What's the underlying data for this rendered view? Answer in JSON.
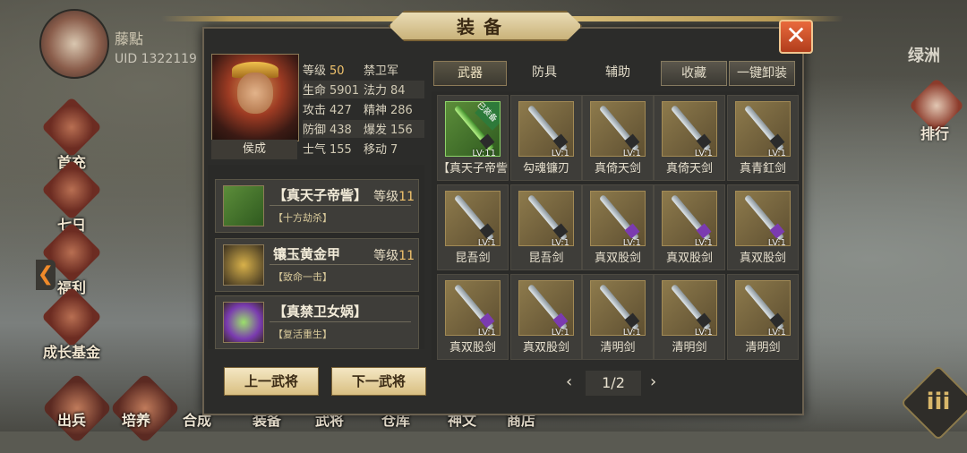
{
  "background": {
    "player_name": "藤點",
    "uid": "UID  1322119",
    "left_menu": [
      "首充",
      "七日",
      "福利",
      "成长基金"
    ],
    "bottom_menu": [
      "出兵",
      "培养",
      "合成",
      "装备",
      "武将",
      "仓库",
      "神文",
      "商店"
    ],
    "right_label": "绿洲",
    "rank_label": "排行"
  },
  "dialog": {
    "title": "装备",
    "close_symbol": "✕",
    "hero": {
      "name": "侯成",
      "stats": [
        [
          {
            "k": "等级",
            "v": "50",
            "highlight": true
          },
          {
            "k": "禁卫军",
            "v": ""
          }
        ],
        [
          {
            "k": "生命",
            "v": "5901"
          },
          {
            "k": "法力",
            "v": "84"
          }
        ],
        [
          {
            "k": "攻击",
            "v": "427"
          },
          {
            "k": "精神",
            "v": "286"
          }
        ],
        [
          {
            "k": "防御",
            "v": "438"
          },
          {
            "k": "爆发",
            "v": "156"
          }
        ],
        [
          {
            "k": "士气",
            "v": "155"
          },
          {
            "k": "移动",
            "v": "7"
          }
        ]
      ]
    },
    "equipped": [
      {
        "name": "【真天子帝訾】",
        "level_label": "等级",
        "level": "11",
        "skill": "【十方劫杀】",
        "icon": "sword-icon"
      },
      {
        "name": "镶玉黄金甲",
        "level_label": "等级",
        "level": "11",
        "skill": "【致命一击】",
        "icon": "armor-icon"
      },
      {
        "name": "【真禁卫女娲】",
        "level_label": "",
        "level": "",
        "skill": "【复活重生】",
        "icon": "gem-icon"
      }
    ],
    "prev_hero": "上一武将",
    "next_hero": "下一武将",
    "tabs": [
      "武器",
      "防具",
      "辅助"
    ],
    "favorite": "收藏",
    "unequip_all": "一键卸装",
    "equipped_badge": "已装备",
    "items": [
      {
        "name": "【真天子帝訾",
        "lv": "LV:11",
        "style": "green"
      },
      {
        "name": "勾魂镰刃",
        "lv": "LV:1",
        "style": "scythe"
      },
      {
        "name": "真倚天剑",
        "lv": "LV:1",
        "style": "sword"
      },
      {
        "name": "真倚天剑",
        "lv": "LV:1",
        "style": "sword"
      },
      {
        "name": "真青釭剑",
        "lv": "LV:1",
        "style": "sword"
      },
      {
        "name": "昆吾剑",
        "lv": "LV:1",
        "style": "sword"
      },
      {
        "name": "昆吾剑",
        "lv": "LV:1",
        "style": "sword"
      },
      {
        "name": "真双股剑",
        "lv": "LV:1",
        "style": "purple"
      },
      {
        "name": "真双股剑",
        "lv": "LV:1",
        "style": "purple"
      },
      {
        "name": "真双股剑",
        "lv": "LV:1",
        "style": "purple"
      },
      {
        "name": "真双股剑",
        "lv": "LV:1",
        "style": "purple"
      },
      {
        "name": "真双股剑",
        "lv": "LV:1",
        "style": "purple"
      },
      {
        "name": "清明剑",
        "lv": "LV:1",
        "style": "sword"
      },
      {
        "name": "清明剑",
        "lv": "LV:1",
        "style": "sword"
      },
      {
        "name": "清明剑",
        "lv": "LV:1",
        "style": "sword"
      }
    ],
    "page": "1/2",
    "prev_page": "‹",
    "next_page": "›"
  }
}
